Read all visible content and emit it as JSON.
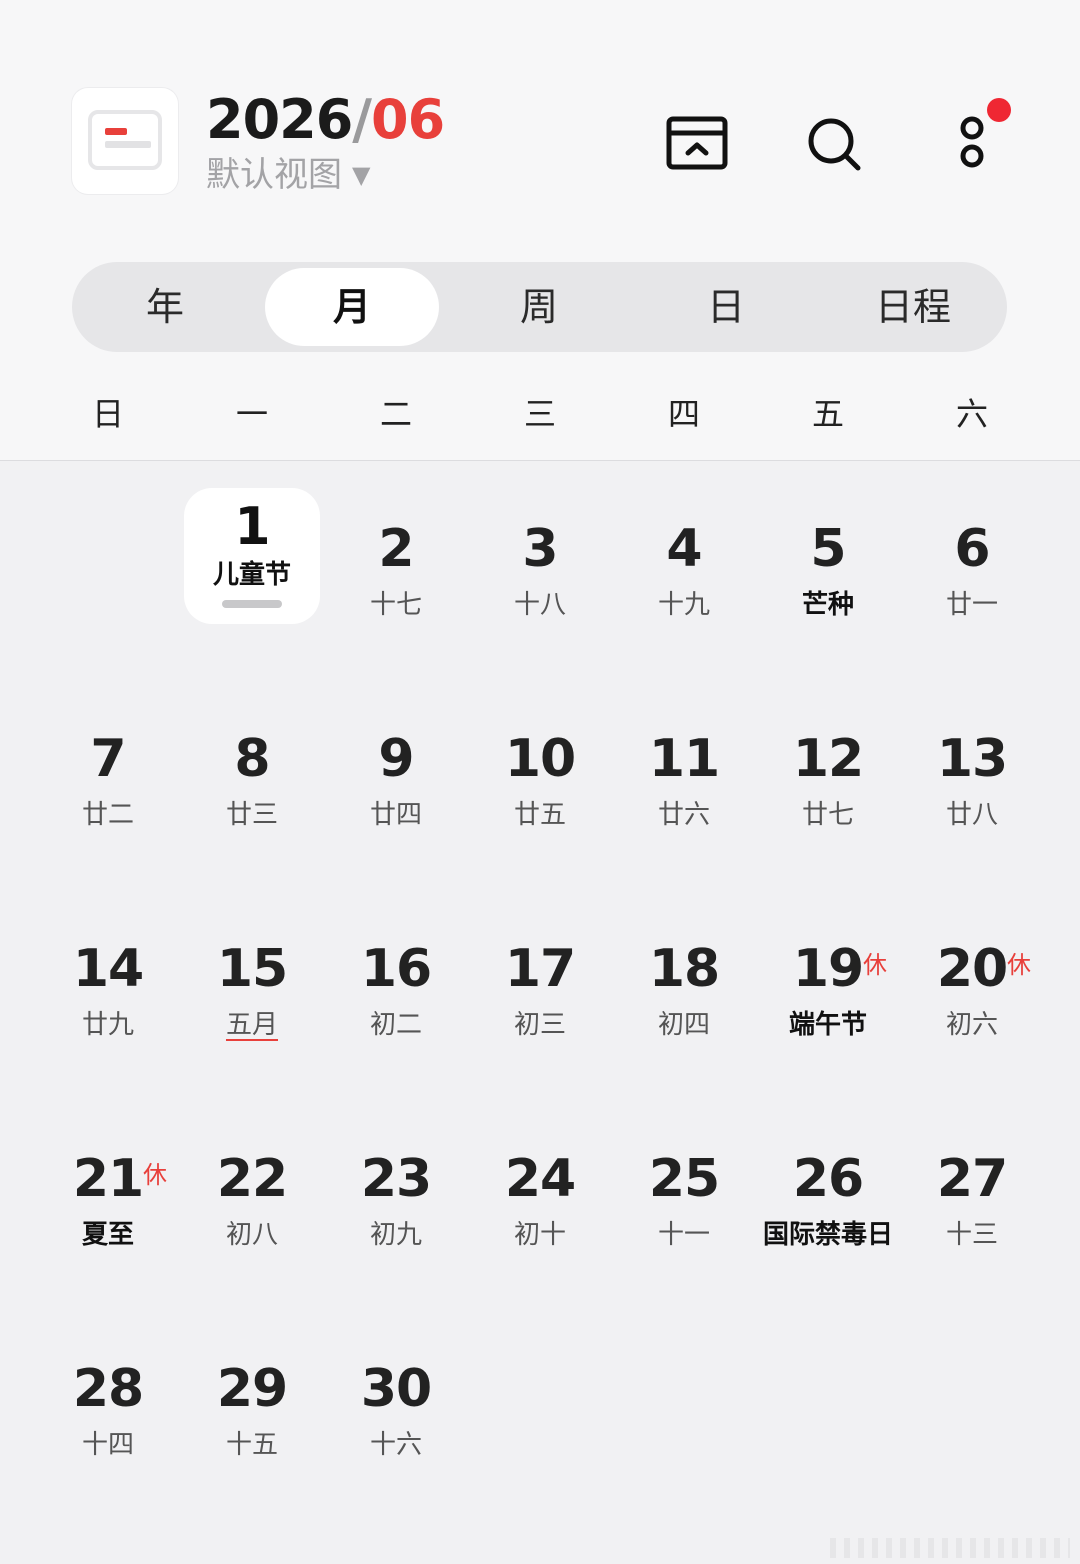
{
  "header": {
    "year": "2026",
    "separator": "/",
    "month": "06",
    "view_label": "默认视图",
    "view_caret": "▼",
    "icons": [
      "app-calendar-icon",
      "inbox-icon",
      "search-icon",
      "more-icon"
    ],
    "accent_color": "#e8403b",
    "notification_dot_color": "#ef2733"
  },
  "tabs": [
    {
      "label": "年",
      "active": false
    },
    {
      "label": "月",
      "active": true
    },
    {
      "label": "周",
      "active": false
    },
    {
      "label": "日",
      "active": false
    },
    {
      "label": "日程",
      "active": false
    }
  ],
  "weekdays": [
    "日",
    "一",
    "二",
    "三",
    "四",
    "五",
    "六"
  ],
  "days": [
    {
      "day": "1",
      "lunar": "儿童节",
      "today": true
    },
    {
      "day": "2",
      "lunar": "十七"
    },
    {
      "day": "3",
      "lunar": "十八"
    },
    {
      "day": "4",
      "lunar": "十九"
    },
    {
      "day": "5",
      "lunar": "芒种",
      "strong": true
    },
    {
      "day": "6",
      "lunar": "廿一"
    },
    {
      "day": "7",
      "lunar": "廿二"
    },
    {
      "day": "8",
      "lunar": "廿三"
    },
    {
      "day": "9",
      "lunar": "廿四"
    },
    {
      "day": "10",
      "lunar": "廿五"
    },
    {
      "day": "11",
      "lunar": "廿六"
    },
    {
      "day": "12",
      "lunar": "廿七"
    },
    {
      "day": "13",
      "lunar": "廿八"
    },
    {
      "day": "14",
      "lunar": "廿九"
    },
    {
      "day": "15",
      "lunar": "五月",
      "underline": true
    },
    {
      "day": "16",
      "lunar": "初二"
    },
    {
      "day": "17",
      "lunar": "初三"
    },
    {
      "day": "18",
      "lunar": "初四"
    },
    {
      "day": "19",
      "lunar": "端午节",
      "strong": true,
      "rest": "休"
    },
    {
      "day": "20",
      "lunar": "初六",
      "rest": "休"
    },
    {
      "day": "21",
      "lunar": "夏至",
      "strong": true,
      "rest": "休"
    },
    {
      "day": "22",
      "lunar": "初八"
    },
    {
      "day": "23",
      "lunar": "初九"
    },
    {
      "day": "24",
      "lunar": "初十"
    },
    {
      "day": "25",
      "lunar": "十一"
    },
    {
      "day": "26",
      "lunar": "国际禁毒日",
      "strong": true
    },
    {
      "day": "27",
      "lunar": "十三"
    },
    {
      "day": "28",
      "lunar": "十四"
    },
    {
      "day": "29",
      "lunar": "十五"
    },
    {
      "day": "30",
      "lunar": "十六"
    }
  ],
  "first_weekday_index": 1
}
